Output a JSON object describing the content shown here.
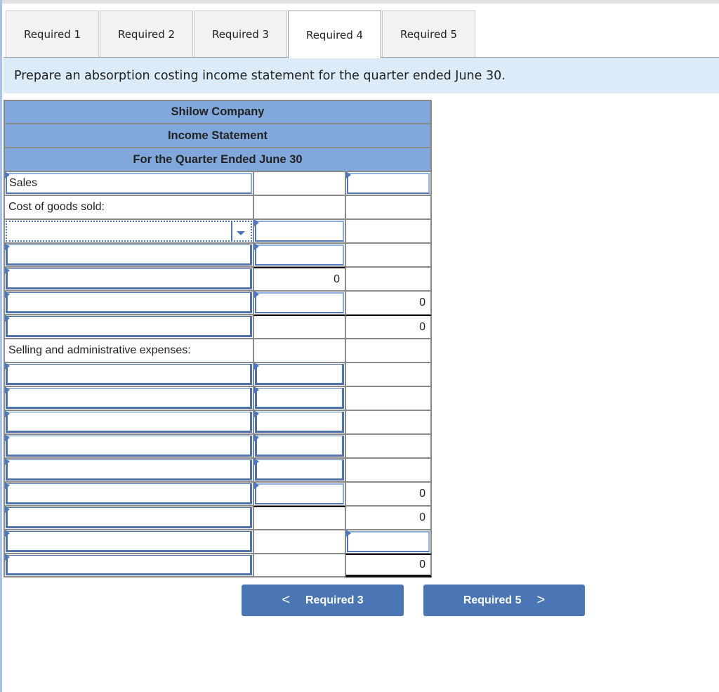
{
  "tabs": [
    {
      "label": "Required 1",
      "active": false
    },
    {
      "label": "Required 2",
      "active": false
    },
    {
      "label": "Required 3",
      "active": false
    },
    {
      "label": "Required 4",
      "active": true
    },
    {
      "label": "Required 5",
      "active": false
    }
  ],
  "instruction": "Prepare an absorption costing income statement for the quarter ended June 30.",
  "statement": {
    "company": "Shilow Company",
    "title": "Income Statement",
    "period": "For the Quarter Ended June 30",
    "rows": [
      {
        "label": "Sales",
        "col2": "",
        "col3": ""
      },
      {
        "label": "Cost of goods sold:",
        "col2": "",
        "col3": ""
      },
      {
        "label": "",
        "col2": "",
        "col3": "",
        "dropdown_value": ""
      },
      {
        "label": "",
        "col2": "",
        "col3": ""
      },
      {
        "label": "",
        "col2": "0",
        "col3": ""
      },
      {
        "label": "",
        "col2": "",
        "col3": "0"
      },
      {
        "label": "",
        "col2": "",
        "col3": "0"
      },
      {
        "label": "Selling and administrative expenses:",
        "col2": "",
        "col3": ""
      },
      {
        "label": "",
        "col2": "",
        "col3": ""
      },
      {
        "label": "",
        "col2": "",
        "col3": ""
      },
      {
        "label": "",
        "col2": "",
        "col3": ""
      },
      {
        "label": "",
        "col2": "",
        "col3": ""
      },
      {
        "label": "",
        "col2": "",
        "col3": ""
      },
      {
        "label": "",
        "col2": "",
        "col3": "0"
      },
      {
        "label": "",
        "col2": "",
        "col3": "0"
      },
      {
        "label": "",
        "col2": "",
        "col3": ""
      },
      {
        "label": "",
        "col2": "",
        "col3": "0"
      }
    ]
  },
  "navigation": {
    "prev_label": "Required 3",
    "next_label": "Required 5",
    "prev_icon": "chevron-left-icon",
    "next_icon": "chevron-right-icon",
    "prev_glyph": "<",
    "next_glyph": ">"
  },
  "colors": {
    "header_blue": "#80a8dd",
    "button_blue": "#4a76b4",
    "instruction_bg": "#dcebf8",
    "input_border": "#4f79b7"
  }
}
